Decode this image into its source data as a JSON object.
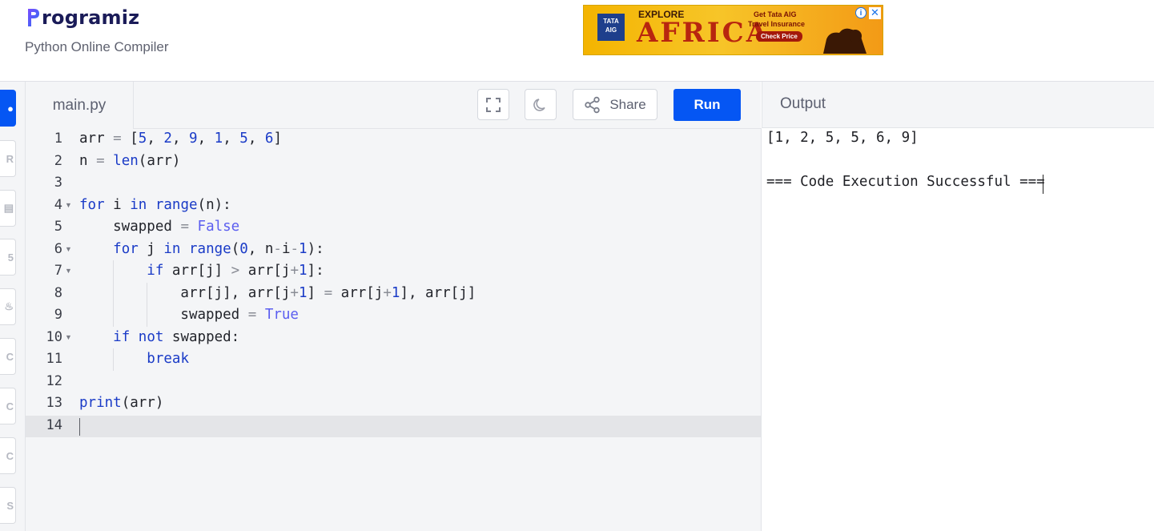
{
  "brand": {
    "name": "rogramiz",
    "subtitle": "Python Online Compiler",
    "accent": "#0556f3",
    "logo_color": "#1a1b58"
  },
  "ad": {
    "brand": "TATA AIG",
    "headline_small": "EXPLORE",
    "headline": "AFRICA",
    "line1": "Get Tata AIG",
    "line2": "Travel Insurance",
    "cta": "Check Price",
    "info_icon": "i",
    "close_icon": "✕"
  },
  "sidebar": {
    "items": [
      {
        "icon": "python-icon",
        "glyph": "●"
      },
      {
        "icon": "r-icon",
        "glyph": "R"
      },
      {
        "icon": "sql-icon",
        "glyph": "▤"
      },
      {
        "icon": "html-icon",
        "glyph": "5"
      },
      {
        "icon": "java-icon",
        "glyph": "♨"
      },
      {
        "icon": "c-icon",
        "glyph": "C"
      },
      {
        "icon": "cpp-icon",
        "glyph": "C"
      },
      {
        "icon": "csharp-icon",
        "glyph": "C"
      },
      {
        "icon": "js-icon",
        "glyph": "S"
      }
    ]
  },
  "editor": {
    "file_name": "main.py",
    "fullscreen_icon": "fullscreen-icon",
    "theme_icon": "moon-icon",
    "share_label": "Share",
    "run_label": "Run",
    "lines": [
      "arr = [5, 2, 9, 1, 5, 6]",
      "n = len(arr)",
      "",
      "for i in range(n):",
      "    swapped = False",
      "    for j in range(0, n-i-1):",
      "        if arr[j] > arr[j+1]:",
      "            arr[j], arr[j+1] = arr[j+1], arr[j]",
      "            swapped = True",
      "    if not swapped:",
      "        break",
      "",
      "print(arr)",
      ""
    ],
    "line_numbers": [
      "1",
      "2",
      "3",
      "4",
      "5",
      "6",
      "7",
      "8",
      "9",
      "10",
      "11",
      "12",
      "13",
      "14"
    ],
    "fold_lines": [
      4,
      6,
      7,
      10
    ],
    "active_line": 14
  },
  "output": {
    "title": "Output",
    "lines": [
      "[1, 2, 5, 5, 6, 9]",
      "",
      "=== Code Execution Successful ==="
    ]
  }
}
